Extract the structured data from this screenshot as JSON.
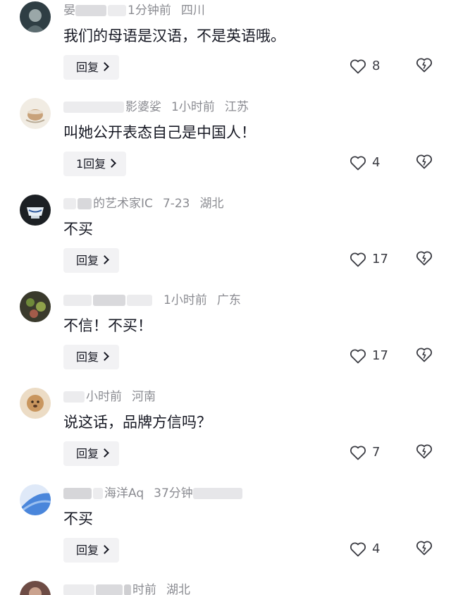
{
  "comments": [
    {
      "meta_before": "晏",
      "meta_time": "分钟前",
      "meta_time_prefix": "1",
      "meta_location": "四川",
      "text": "我们的母语是汉语，不是英语哦。",
      "reply_label": "回复",
      "like_count": "8",
      "avatar_color": "#2b3a40"
    },
    {
      "meta_before": "",
      "meta_time_prefix": "影婆娑",
      "meta_time": "1小时前",
      "meta_location": "江苏",
      "text": "叫她公开表态自己是中国人！",
      "reply_label": "1回复",
      "like_count": "4",
      "avatar_color": "#e9e2d6"
    },
    {
      "meta_before": "",
      "meta_time_prefix": "的艺术家IC",
      "meta_time": "7-23",
      "meta_location": "湖北",
      "text": "不买",
      "reply_label": "回复",
      "like_count": "17",
      "avatar_color": "#1f2326"
    },
    {
      "meta_before": "",
      "meta_time_prefix": "",
      "meta_time": "1小时前",
      "meta_location": "广东",
      "text": "不信！不买！",
      "reply_label": "回复",
      "like_count": "17",
      "avatar_color": "#3b3a2e"
    },
    {
      "meta_before": "",
      "meta_time_prefix": "",
      "meta_time": "小时前",
      "meta_location": "河南",
      "text": "说这话，品牌方信吗？",
      "reply_label": "回复",
      "like_count": "7",
      "avatar_color": "#e8d2b4"
    },
    {
      "meta_before": "",
      "meta_time_prefix": "海洋Aq",
      "meta_time": "37分钟",
      "meta_location": "",
      "text": "不买",
      "reply_label": "回复",
      "like_count": "4",
      "avatar_color": "#3f7fd6"
    },
    {
      "meta_before": "",
      "meta_time_prefix": "",
      "meta_time": "时前",
      "meta_location": "湖北",
      "text": "",
      "reply_label": "",
      "like_count": "",
      "avatar_color": "#6b4a45"
    }
  ],
  "icons": {
    "like": "heart-outline-icon",
    "dislike": "broken-heart-icon",
    "reply_chevron": "chevron-right-icon"
  }
}
